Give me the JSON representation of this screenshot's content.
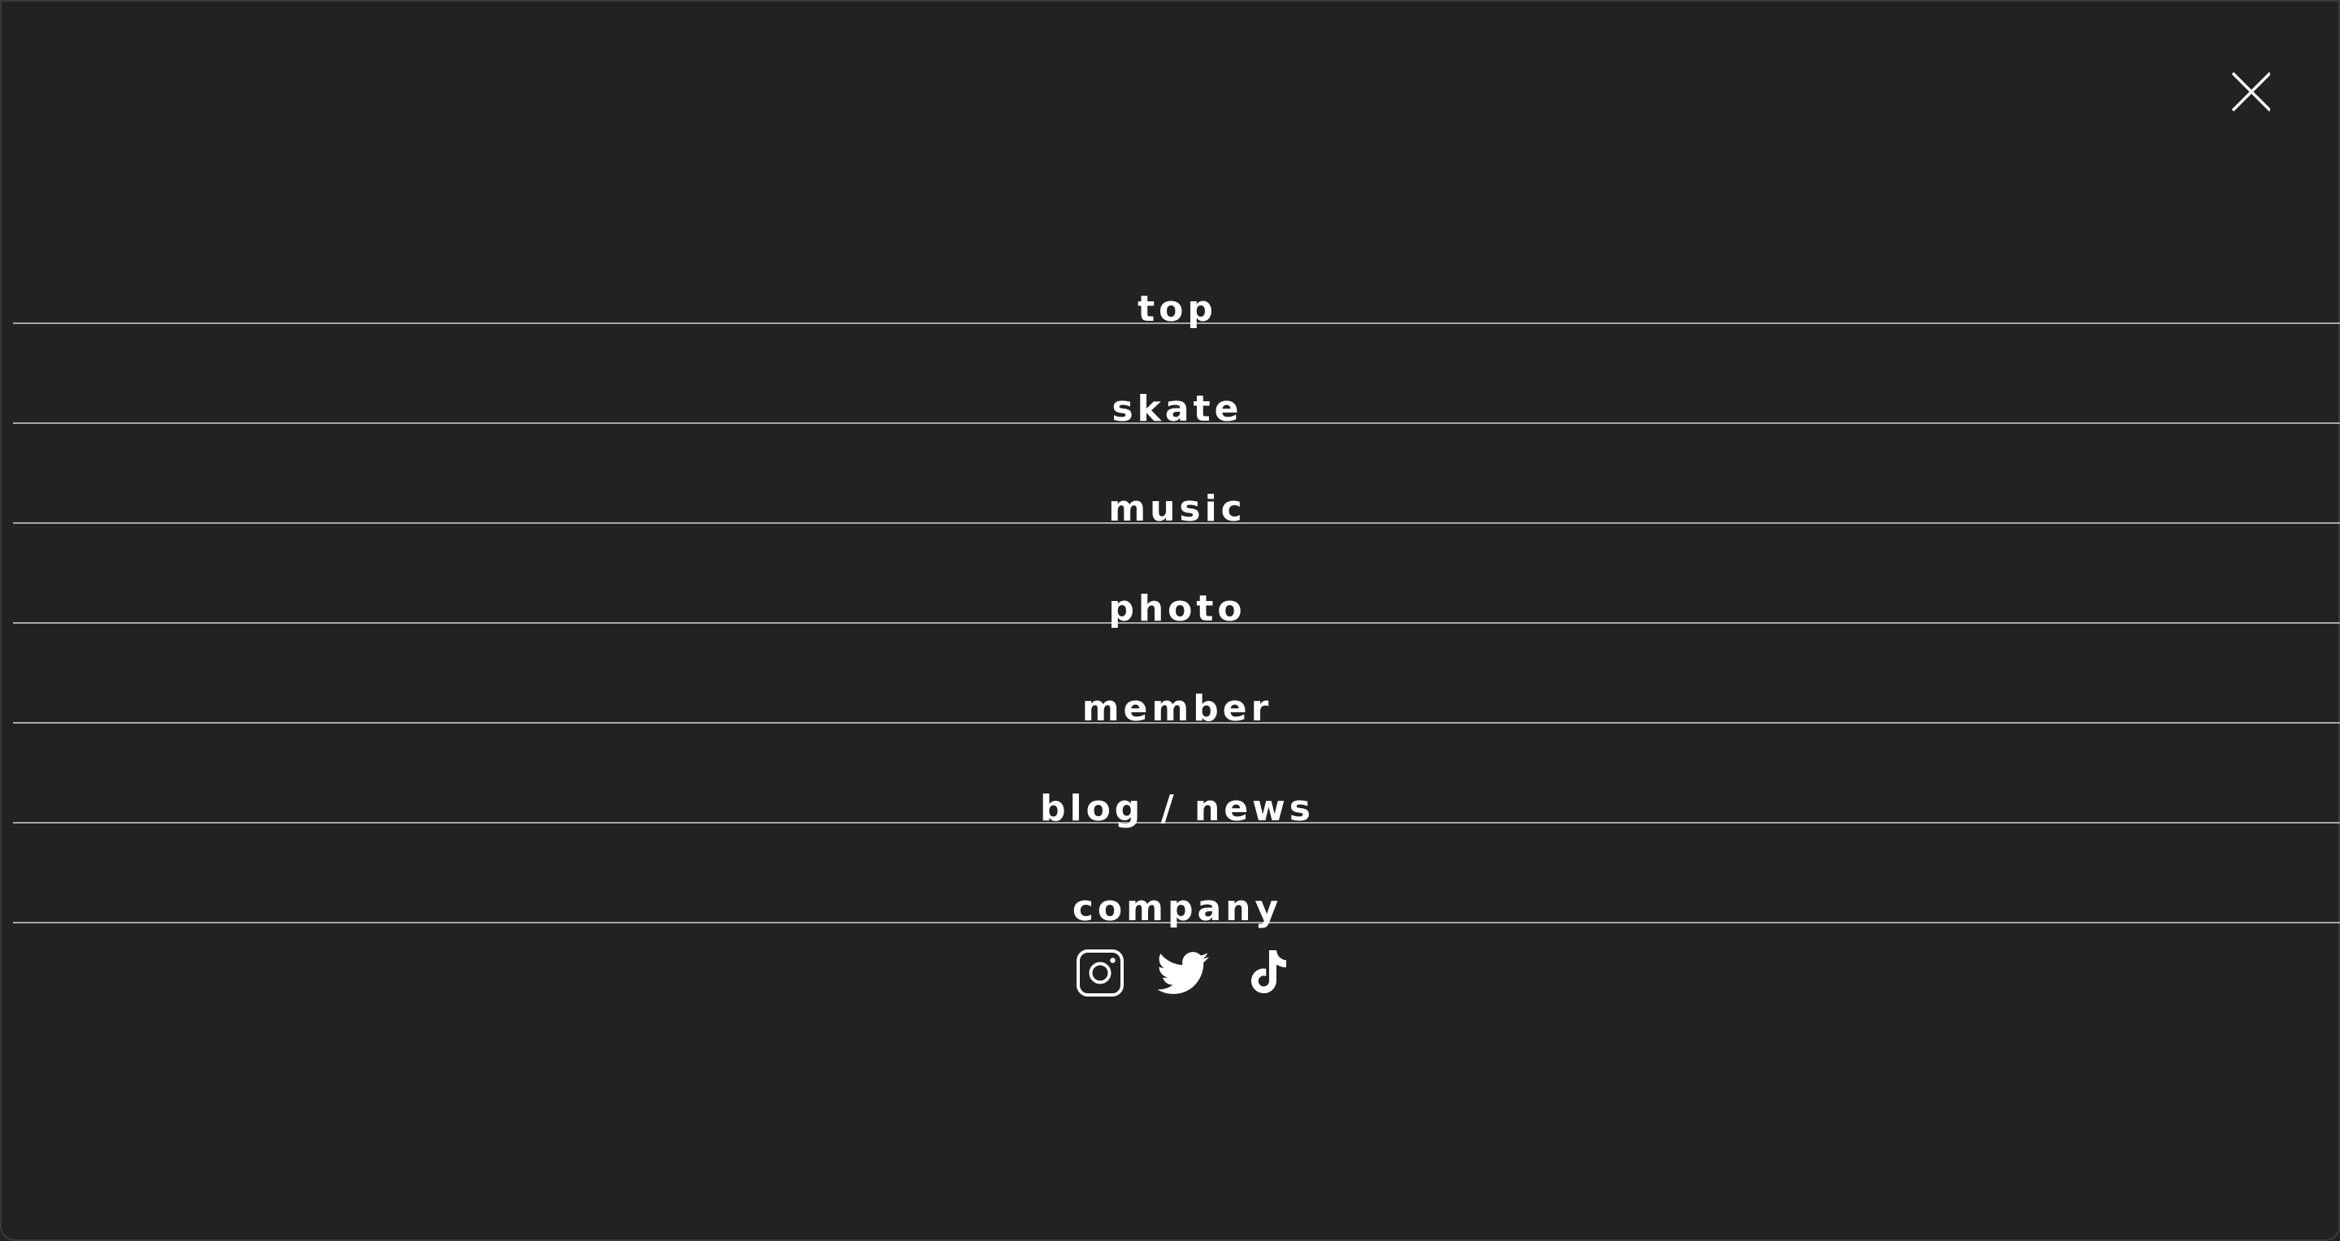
{
  "close": {
    "icon": "close-icon"
  },
  "menu": {
    "items": [
      {
        "label": "top"
      },
      {
        "label": "skate"
      },
      {
        "label": "music"
      },
      {
        "label": "photo"
      },
      {
        "label": "member"
      },
      {
        "label": "blog / news"
      },
      {
        "label": "company"
      }
    ]
  },
  "social": {
    "icons": [
      "instagram-icon",
      "twitter-icon",
      "tiktok-icon"
    ]
  },
  "colors": {
    "background": "#222222",
    "divider": "#a8a8a8",
    "text": "#ffffff"
  }
}
